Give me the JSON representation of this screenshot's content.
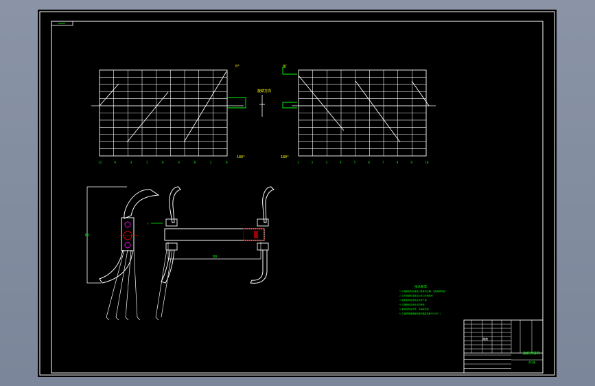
{
  "title_block": {
    "drawing_name": "旋耕刀排列",
    "sheet_label": "共1张",
    "company": "湖南"
  },
  "chart_left": {
    "top_label": "0°",
    "side_label": "180°",
    "x_ticks": [
      "12",
      "9",
      "3",
      "1",
      "6",
      "4",
      "8",
      "2",
      "8"
    ]
  },
  "chart_right": {
    "top_label": "0°",
    "side_label": "180°",
    "x_ticks": [
      "1",
      "2",
      "3",
      "4",
      "5",
      "6",
      "7",
      "8",
      "9",
      "10"
    ]
  },
  "center_label": "旋耕方向",
  "dimension_horizontal": "80",
  "dimension_vertical": "R1",
  "tech_notes": {
    "title": "技术要求",
    "lines": [
      "1.刀轴装配时应保证刀具排列正确，刀座焊接牢固",
      "2.刀片安装时注意左右弯刀交错排列",
      "3.装配前所有零件应清洗干净",
      "4.刀轴转动灵活无卡滞现象",
      "5.各紧固件应拧紧，不得有松动",
      "6.刀轴两端轴承座安装同轴度误差不大于0.1"
    ]
  }
}
